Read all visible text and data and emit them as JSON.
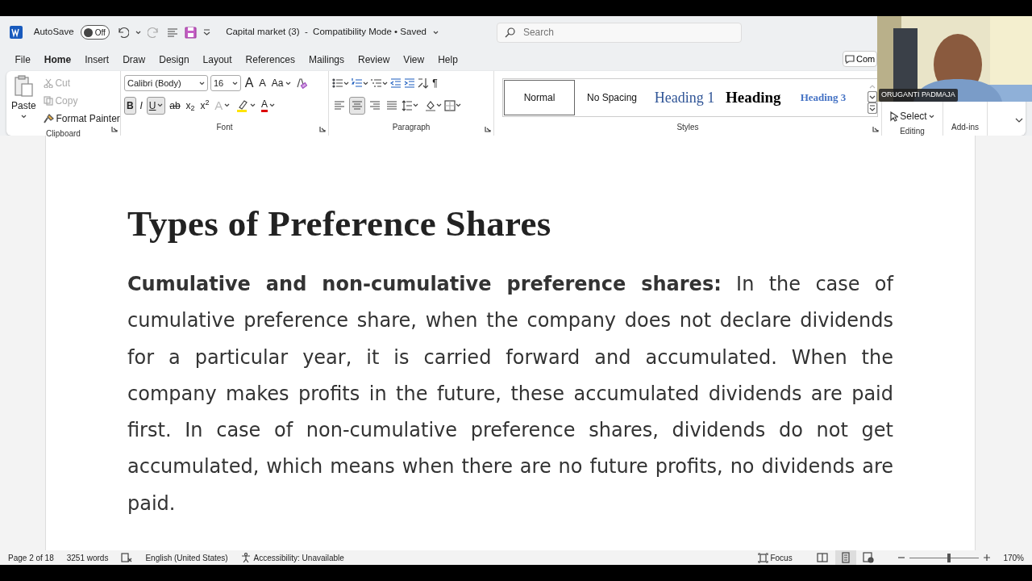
{
  "title_bar": {
    "autosave_label": "AutoSave",
    "autosave_on": false,
    "autosave_state": "Off",
    "document_title": "Capital market (3)  -  Compatibility Mode • Saved",
    "search_placeholder": "Search"
  },
  "menu_tabs": [
    {
      "label": "File",
      "selected": false
    },
    {
      "label": "Home",
      "selected": true
    },
    {
      "label": "Insert",
      "selected": false
    },
    {
      "label": "Draw",
      "selected": false
    },
    {
      "label": "Design",
      "selected": false
    },
    {
      "label": "Layout",
      "selected": false
    },
    {
      "label": "References",
      "selected": false
    },
    {
      "label": "Mailings",
      "selected": false
    },
    {
      "label": "Review",
      "selected": false
    },
    {
      "label": "View",
      "selected": false
    },
    {
      "label": "Help",
      "selected": false
    }
  ],
  "comments_button": "Com",
  "clipboard": {
    "paste": "Paste",
    "cut": "Cut",
    "cut_disabled": true,
    "copy": "Copy",
    "copy_disabled": true,
    "format_painter": "Format Painter",
    "label": "Clipboard"
  },
  "font": {
    "family": "Calibri (Body)",
    "size": "16",
    "label": "Font",
    "row1": [
      {
        "kind": "grow",
        "label": "A"
      },
      {
        "kind": "shrink",
        "label": "A"
      },
      {
        "kind": "case",
        "label": "Aa"
      },
      {
        "kind": "clear"
      }
    ],
    "row2": [
      {
        "kind": "bold",
        "label": "B",
        "on": true
      },
      {
        "kind": "italic",
        "label": "I",
        "on": false
      },
      {
        "kind": "underline",
        "label": "U",
        "on": true
      },
      {
        "kind": "strike",
        "label": "ab"
      },
      {
        "kind": "sub",
        "label": "x$_{2}$"
      },
      {
        "kind": "sup",
        "label": "x$^{2}$"
      },
      {
        "kind": "effects",
        "label": "A"
      },
      {
        "kind": "highlight"
      },
      {
        "kind": "color",
        "label": "A"
      }
    ]
  },
  "paragraph": {
    "label": "Paragraph",
    "pilcrow": "¶",
    "alignments": [
      {
        "kind": "left",
        "selected": false
      },
      {
        "kind": "center",
        "selected": true
      },
      {
        "kind": "right",
        "selected": false
      },
      {
        "kind": "justify",
        "selected": false
      }
    ]
  },
  "styles": {
    "label": "Styles",
    "items": [
      {
        "kind": "normal",
        "label": "Normal",
        "selected": true
      },
      {
        "kind": "plain",
        "label": "No Spacing",
        "selected": false
      },
      {
        "kind": "h1",
        "label": "Heading 1",
        "selected": false
      },
      {
        "kind": "h2",
        "label": "Heading",
        "selected": false
      },
      {
        "kind": "h3",
        "label": "Heading 3",
        "selected": false
      }
    ]
  },
  "editing": {
    "select": "Select",
    "label": "Editing"
  },
  "addins": {
    "label": "Add-ins"
  },
  "video_overlay": {
    "kind": "picture",
    "participant": "ORUGANTI PADMAJA"
  },
  "document": {
    "heading": "Types of Preference Shares",
    "paragraph": "**Cumulative and non-cumulative preference shares:** In the case of cumulative preference share, when the company does not declare dividends for a particular year, it is carried forward and accumulated. When the company makes profits in the future, these accumulated dividends are paid first. In case of non-cumulative preference shares, dividends do not get accumulated, which means when there are no future profits, no dividends are paid."
  },
  "status_bar": {
    "page": "Page 2 of 18",
    "words": "3251 words",
    "language": "English (United States)",
    "accessibility": "Accessibility: Unavailable",
    "focus": "Focus",
    "views": [
      {
        "kind": "read",
        "selected": false
      },
      {
        "kind": "print",
        "selected": true
      },
      {
        "kind": "web",
        "selected": false
      }
    ],
    "zoom": {
      "level": 0.56,
      "reading": "170%"
    }
  }
}
